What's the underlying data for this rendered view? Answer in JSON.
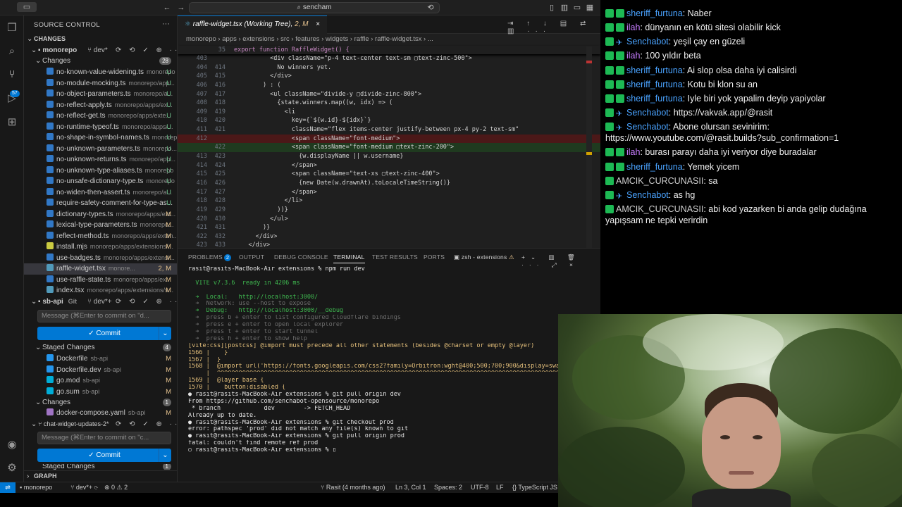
{
  "titlebar": {
    "search": "sencham"
  },
  "activity": {
    "scm_badge": "57"
  },
  "sidebar": {
    "header": "SOURCE CONTROL",
    "changes_header": "CHANGES",
    "repo1": {
      "name": "monorepo",
      "branch": "dev*"
    },
    "changes_label": "Changes",
    "changes_count": "28",
    "files": [
      {
        "name": "no-known-value-widening.ts",
        "path": "monorepo",
        "status": "U"
      },
      {
        "name": "no-module-mocking.ts",
        "path": "monorepo/app...",
        "status": "U"
      },
      {
        "name": "no-object-parameters.ts",
        "path": "monorepo/a...",
        "status": "U"
      },
      {
        "name": "no-reflect-apply.ts",
        "path": "monorepo/apps/ex...",
        "status": "U"
      },
      {
        "name": "no-reflect-get.ts",
        "path": "monorepo/apps/exte...",
        "status": "U"
      },
      {
        "name": "no-runtime-typeof.ts",
        "path": "monorepo/apps/...",
        "status": "U"
      },
      {
        "name": "no-shape-in-symbol-names.ts",
        "path": "monorepo",
        "status": "U"
      },
      {
        "name": "no-unknown-parameters.ts",
        "path": "monorepo...",
        "status": "U"
      },
      {
        "name": "no-unknown-returns.ts",
        "path": "monorepo/app...",
        "status": "U"
      },
      {
        "name": "no-unknown-type-aliases.ts",
        "path": "monorepo",
        "status": "U"
      },
      {
        "name": "no-unsafe-dictionary-type.ts",
        "path": "monorepo",
        "status": "U"
      },
      {
        "name": "no-widen-then-assert.ts",
        "path": "monorepo/a...",
        "status": "U"
      },
      {
        "name": "require-safety-comment-for-type-as...",
        "path": "",
        "status": "U"
      },
      {
        "name": "dictionary-types.ts",
        "path": "monorepo/apps/ext...",
        "status": "M"
      },
      {
        "name": "lexical-type-parameters.ts",
        "path": "monorepo...",
        "status": "M"
      },
      {
        "name": "reflect-method.ts",
        "path": "monorepo/apps/exten...",
        "status": "M"
      },
      {
        "name": "install.mjs",
        "path": "monorepo/apps/extensions/...",
        "status": "M"
      },
      {
        "name": "use-badges.ts",
        "path": "monorepo/apps/extensi...",
        "status": "M"
      },
      {
        "name": "raffle-widget.tsx",
        "path": "monore...",
        "status": "2, M"
      },
      {
        "name": "use-raffle-state.ts",
        "path": "monorepo/apps/ex...",
        "status": "M"
      },
      {
        "name": "index.tsx",
        "path": "monorepo/apps/extensions/s...",
        "status": "M"
      }
    ],
    "repo2": {
      "name": "sb-api",
      "vcs": "Git",
      "branch": "dev*+"
    },
    "message_placeholder": "Message (⌘Enter to commit on \"d...",
    "commit_label": "✓ Commit",
    "staged_label": "Staged Changes",
    "staged_count": "4",
    "staged_files": [
      {
        "name": "Dockerfile",
        "path": "sb-api",
        "status": "M"
      },
      {
        "name": "Dockerfile.dev",
        "path": "sb-api",
        "status": "M"
      },
      {
        "name": "go.mod",
        "path": "sb-api",
        "status": "M"
      },
      {
        "name": "go.sum",
        "path": "sb-api",
        "status": "M"
      }
    ],
    "changes2_label": "Changes",
    "changes2_count": "1",
    "changes2_files": [
      {
        "name": "docker-compose.yaml",
        "path": "sb-api",
        "status": "M"
      }
    ],
    "repo3": {
      "name": "chat-widget-updates-2*"
    },
    "message_placeholder2": "Message (⌘Enter to commit on \"c...",
    "staged2_label": "Staged Changes",
    "staged2_count": "1",
    "graph_label": "GRAPH"
  },
  "editor": {
    "tab": "raffle-widget.tsx (Working Tree)",
    "tab_status": "2, M",
    "breadcrumb": "monorepo  ›  apps  ›  extensions  ›  src  ›  features  ›  widgets  ›  raffle  ›  raffle-widget.tsx  ›  ...",
    "sticky_num": "35",
    "sticky_text": "export function RaffleWidget() {",
    "lines": [
      {
        "l": "403",
        "r": "",
        "text": "          <div className=\"p-4 text-center text-sm ▢text-zinc-500\">",
        "cls": ""
      },
      {
        "l": "404",
        "r": "414",
        "text": "            No winners yet.",
        "cls": ""
      },
      {
        "l": "405",
        "r": "415",
        "text": "          </div>",
        "cls": ""
      },
      {
        "l": "406",
        "r": "416",
        "text": "        ) : (",
        "cls": ""
      },
      {
        "l": "407",
        "r": "417",
        "text": "          <ul className=\"divide-y ▢divide-zinc-800\">",
        "cls": ""
      },
      {
        "l": "408",
        "r": "418",
        "text": "            {state.winners.map((w, idx) => (",
        "cls": ""
      },
      {
        "l": "409",
        "r": "419",
        "text": "              <li",
        "cls": ""
      },
      {
        "l": "410",
        "r": "420",
        "text": "                key={`${w.id}-${idx}`}",
        "cls": ""
      },
      {
        "l": "411",
        "r": "421",
        "text": "                className=\"flex items-center justify-between px-4 py-2 text-sm\"",
        "cls": ""
      },
      {
        "l": "412",
        "r": "",
        "text": "                <span className=\"font-medium\">",
        "cls": "del"
      },
      {
        "l": "",
        "r": "422",
        "text": "                <span className=\"font-medium ▢text-zinc-200\">",
        "cls": "add"
      },
      {
        "l": "413",
        "r": "423",
        "text": "                  {w.displayName || w.username}",
        "cls": ""
      },
      {
        "l": "414",
        "r": "424",
        "text": "                </span>",
        "cls": ""
      },
      {
        "l": "415",
        "r": "425",
        "text": "                <span className=\"text-xs ▢text-zinc-400\">",
        "cls": ""
      },
      {
        "l": "416",
        "r": "426",
        "text": "                  {new Date(w.drawnAt).toLocaleTimeString()}",
        "cls": ""
      },
      {
        "l": "417",
        "r": "427",
        "text": "                </span>",
        "cls": ""
      },
      {
        "l": "418",
        "r": "428",
        "text": "              </li>",
        "cls": ""
      },
      {
        "l": "419",
        "r": "429",
        "text": "            ))}",
        "cls": ""
      },
      {
        "l": "420",
        "r": "430",
        "text": "          </ul>",
        "cls": ""
      },
      {
        "l": "421",
        "r": "431",
        "text": "        )}",
        "cls": ""
      },
      {
        "l": "422",
        "r": "432",
        "text": "      </div>",
        "cls": ""
      },
      {
        "l": "423",
        "r": "433",
        "text": "    </div>",
        "cls": ""
      }
    ]
  },
  "panel": {
    "tabs": [
      "PROBLEMS",
      "OUTPUT",
      "DEBUG CONSOLE",
      "TERMINAL",
      "TEST RESULTS",
      "PORTS"
    ],
    "problems_count": "2",
    "shell": "zsh - extensions",
    "terminal": [
      {
        "c": "t-w",
        "t": "rasit@rasits-MacBook-Air extensions % npm run dev"
      },
      {
        "c": "t-w",
        "t": ""
      },
      {
        "c": "t-g",
        "t": "  VITE v7.3.6  ready in 4206 ms"
      },
      {
        "c": "t-w",
        "t": ""
      },
      {
        "c": "t-g",
        "t": "  ➜  Local:   http://localhost:3000/"
      },
      {
        "c": "t-dim",
        "t": "  ➜  Network: use --host to expose"
      },
      {
        "c": "t-g",
        "t": "  ➜  Debug:   http://localhost:3000/__debug"
      },
      {
        "c": "t-dim",
        "t": "  ➜  press b + enter to list configured Cloudflare bindings"
      },
      {
        "c": "t-dim",
        "t": "  ➜  press e + enter to open local explorer"
      },
      {
        "c": "t-dim",
        "t": "  ➜  press t + enter to start tunnel"
      },
      {
        "c": "t-dim",
        "t": "  ➜  press h + enter to show help"
      },
      {
        "c": "t-y",
        "t": "[vite:css][postcss] @import must precede all other statements (besides @charset or empty @layer)"
      },
      {
        "c": "t-y",
        "t": "1566 |    }"
      },
      {
        "c": "t-y",
        "t": "1567 |  }"
      },
      {
        "c": "t-y",
        "t": "1568 |  @import url('https://fonts.googleapis.com/css2?family=Orbitron:wght@400;500;700;900&display=swap');"
      },
      {
        "c": "t-y",
        "t": "     |  ^^^^^^^^^^^^^^^^^^^^^^^^^^^^^^^^^^^^^^^^^^^^^^^^^^^^^^^^^^^^^^^^^^^^^^^^^^^^^^^^^^^^^^^^^^^^^^^"
      },
      {
        "c": "t-y",
        "t": "1569 |  @layer base {"
      },
      {
        "c": "t-y",
        "t": "1570 |    button:disabled {"
      },
      {
        "c": "t-w",
        "t": "● rasit@rasits-MacBook-Air extensions % git pull origin dev"
      },
      {
        "c": "t-w",
        "t": "From https://github.com/senchabot-opensource/monorepo"
      },
      {
        "c": "t-w",
        "t": " * branch            dev        -> FETCH_HEAD"
      },
      {
        "c": "t-w",
        "t": "Already up to date."
      },
      {
        "c": "t-w",
        "t": "● rasit@rasits-MacBook-Air extensions % git checkout prod"
      },
      {
        "c": "t-w",
        "t": "error: pathspec 'prod' did not match any file(s) known to git"
      },
      {
        "c": "t-w",
        "t": "● rasit@rasits-MacBook-Air extensions % git pull origin prod"
      },
      {
        "c": "t-w",
        "t": "fatal: couldn't find remote ref prod"
      },
      {
        "c": "t-w",
        "t": "○ rasit@rasits-MacBook-Air extensions % ▯"
      }
    ]
  },
  "status": {
    "branch": "monorepo",
    "git": "dev*+",
    "problems": "⊗ 0  ⚠ 2",
    "blame": "Rasit (4 months ago)",
    "position": "Ln 3, Col 1",
    "spaces": "Spaces: 2",
    "encoding": "UTF-8",
    "eol": "LF",
    "language": "{} TypeScript JS"
  },
  "chat": [
    {
      "user": "sheriff_furtuna",
      "color": "#4aa3ff",
      "badges": "mod",
      "msg": "Naber"
    },
    {
      "user": "ilah",
      "color": "#c77dff",
      "badges": "mod",
      "msg": "dünyanın en kötü sitesi olabilir kick"
    },
    {
      "user": "Senchabot",
      "color": "#4aa3ff",
      "badges": "bot",
      "msg": "yeşil çay en güzeli"
    },
    {
      "user": "ilah",
      "color": "#c77dff",
      "badges": "mod",
      "msg": "100 yıldır beta"
    },
    {
      "user": "sheriff_furtuna",
      "color": "#4aa3ff",
      "badges": "mod",
      "msg": "Ai slop olsa daha iyi calisirdi"
    },
    {
      "user": "sheriff_furtuna",
      "color": "#4aa3ff",
      "badges": "mod",
      "msg": "Kotu bi klon su an"
    },
    {
      "user": "sheriff_furtuna",
      "color": "#4aa3ff",
      "badges": "mod",
      "msg": "Iyle biri yok yapalim deyip yapiyolar"
    },
    {
      "user": "Senchabot",
      "color": "#4aa3ff",
      "badges": "bot",
      "msg": "https://vakvak.app/@rasit"
    },
    {
      "user": "Senchabot",
      "color": "#4aa3ff",
      "badges": "bot",
      "msg": "Abone olursan sevinirim: https://www.youtube.com/@rasit.builds?sub_confirmation=1"
    },
    {
      "user": "ilah",
      "color": "#c77dff",
      "badges": "mod",
      "msg": "burası parayı daha iyi veriyor diye buradalar"
    },
    {
      "user": "sheriff_furtuna",
      "color": "#4aa3ff",
      "badges": "mod",
      "msg": "Yemek yicem"
    },
    {
      "user": "AMCIK_CURCUNASII",
      "color": "#d0d0d0",
      "badges": "none",
      "msg": "sa"
    },
    {
      "user": "Senchabot",
      "color": "#4aa3ff",
      "badges": "bot",
      "msg": "as hg"
    },
    {
      "user": "AMCIK_CURCUNASII",
      "color": "#d0d0d0",
      "badges": "none",
      "msg": "abi kod yazarken bi anda gelip dudağına yapışsam ne tepki verirdin"
    }
  ]
}
